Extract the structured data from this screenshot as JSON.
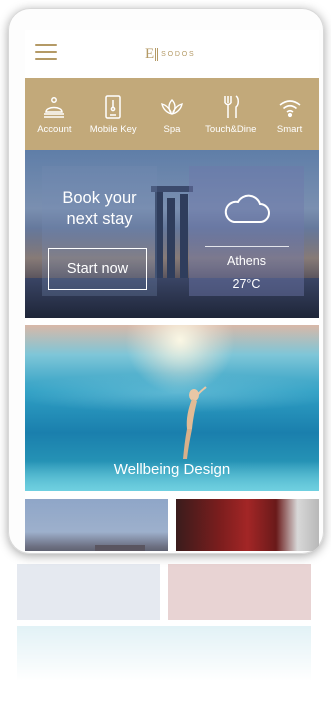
{
  "header": {
    "menu_icon": "hamburger-icon",
    "logo_mark": "E",
    "logo_text": "SODOS"
  },
  "menu": {
    "items": [
      {
        "label": "Account",
        "icon": "concierge-bell-icon"
      },
      {
        "label": "Mobile Key",
        "icon": "mobile-key-icon"
      },
      {
        "label": "Spa",
        "icon": "lotus-icon"
      },
      {
        "label": "Touch&Dine",
        "icon": "fork-knife-icon"
      },
      {
        "label": "Smart",
        "icon": "wifi-icon"
      }
    ],
    "background_color": "#c2a97a"
  },
  "hero": {
    "book_title_line1": "Book your",
    "book_title_line2": "next stay",
    "cta_label": "Start now",
    "weather_icon": "cloud-icon",
    "weather_city": "Athens",
    "weather_temp": "27°C"
  },
  "wellbeing": {
    "label": "Wellbeing Design"
  },
  "colors": {
    "accent": "#b49a66",
    "menu_bar": "#c2a97a"
  }
}
